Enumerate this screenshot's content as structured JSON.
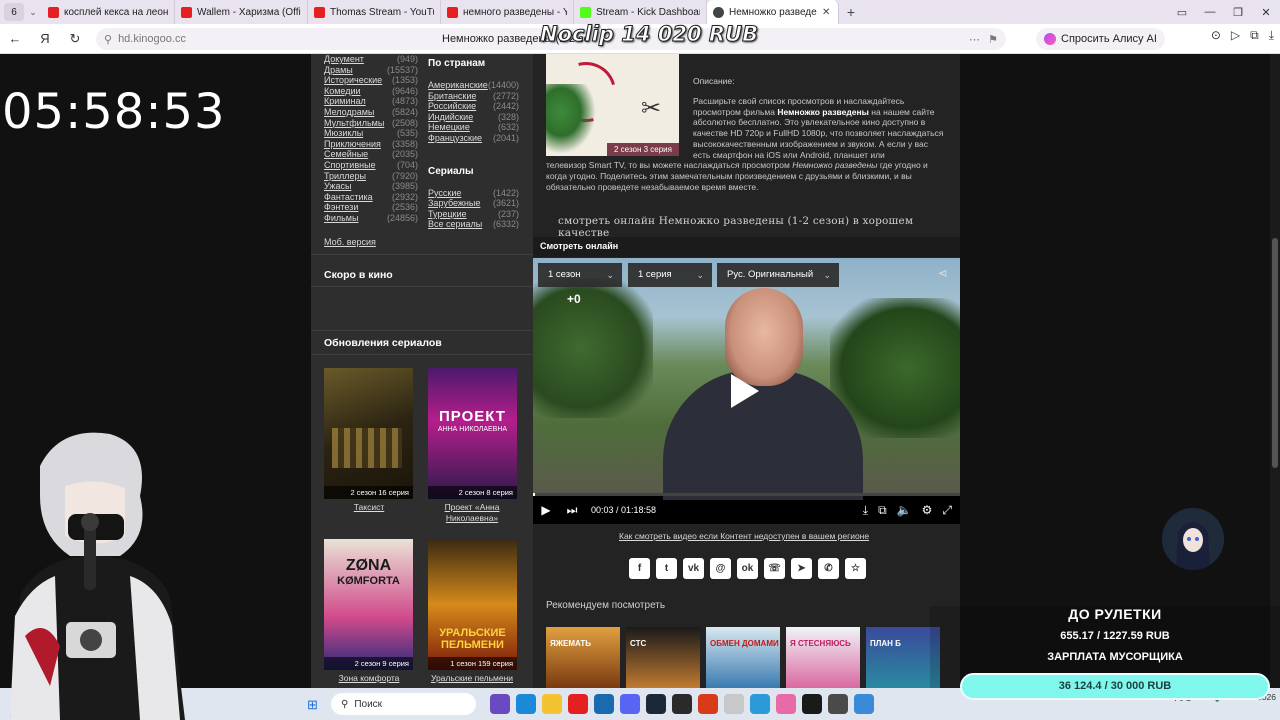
{
  "browser": {
    "tab_count": "6",
    "tabs": [
      {
        "label": "косплей кекса на леона -",
        "color": "#e52020"
      },
      {
        "label": "Wallem - Харизма (Offici",
        "color": "#e52020"
      },
      {
        "label": "Thomas Stream - YouTub",
        "color": "#e52020"
      },
      {
        "label": "немного разведены - You",
        "color": "#e52020"
      },
      {
        "label": "Stream - Kick Dashboard",
        "color": "#53fc18"
      },
      {
        "label": "Немножко разведены",
        "color": "#444444"
      }
    ],
    "url": "hd.kinogoo.cc",
    "page_title": "Немножко разведены (1-2 се",
    "alice_label": "Спросить Алису AI"
  },
  "overlay": {
    "title": "Noclip 14 020 RUB",
    "clock": "05:58:53",
    "roulette_title": "ДО РУЛЕТКИ",
    "roulette_value": "655.17 / 1227.59 RUB",
    "salary_title": "ЗАРПЛАТА МУСОРЩИКА",
    "salary_value": "36 124.4 / 30 000 RUB"
  },
  "sidebar": {
    "genres": [
      {
        "name": "Документ",
        "count": "(949)"
      },
      {
        "name": "Драмы",
        "count": "(15537)"
      },
      {
        "name": "Исторические",
        "count": "(1353)"
      },
      {
        "name": "Комедии",
        "count": "(9646)"
      },
      {
        "name": "Криминал",
        "count": "(4873)"
      },
      {
        "name": "Мелодрамы",
        "count": "(5824)"
      },
      {
        "name": "Мультфильмы",
        "count": "(2508)"
      },
      {
        "name": "Мюзиклы",
        "count": "(535)"
      },
      {
        "name": "Приключения",
        "count": "(3358)"
      },
      {
        "name": "Семейные",
        "count": "(2035)"
      },
      {
        "name": "Спортивные",
        "count": "(704)"
      },
      {
        "name": "Триллеры",
        "count": "(7920)"
      },
      {
        "name": "Ужасы",
        "count": "(3985)"
      },
      {
        "name": "Фантастика",
        "count": "(2932)"
      },
      {
        "name": "Фэнтези",
        "count": "(2536)"
      },
      {
        "name": "Фильмы",
        "count": "(24856)"
      }
    ],
    "countries_title": "По странам",
    "countries": [
      {
        "name": "Американские",
        "count": "(14400)"
      },
      {
        "name": "Британские",
        "count": "(2772)"
      },
      {
        "name": "Российские",
        "count": "(2442)"
      },
      {
        "name": "Индийские",
        "count": "(328)"
      },
      {
        "name": "Немецкие",
        "count": "(632)"
      },
      {
        "name": "Французские",
        "count": "(2041)"
      }
    ],
    "series_title": "Сериалы",
    "series": [
      {
        "name": "Русские",
        "count": "(1422)"
      },
      {
        "name": "Зарубежные",
        "count": "(3621)"
      },
      {
        "name": "Турецкие",
        "count": "(237)"
      },
      {
        "name": "Все сериалы",
        "count": "(6332)"
      }
    ],
    "mobile_link": "Моб. версия",
    "soon_title": "Скоро в кино",
    "updates_title": "Обновления сериалов",
    "posters": [
      {
        "badge": "2 сезон 16 серия",
        "caption": "Таксист"
      },
      {
        "badge": "2 сезон 8 серия",
        "caption": "Проект «Анна Николаевна»"
      },
      {
        "badge": "2 сезон 9 серия",
        "caption": "Зона комфорта"
      },
      {
        "badge": "1 сезон 159 серия",
        "caption": "Уральские пельмени"
      }
    ]
  },
  "main": {
    "poster_badge": "2 сезон 3 серия",
    "desc_label": "Описание:",
    "desc_p1": "Расширьте свой список просмотров и наслаждайтесь просмотром фильма",
    "desc_bold": "Немножко разведены",
    "desc_p2": "на нашем сайте абсолютно бесплатно. Это увлекательное кино доступно в качестве HD 720p и FullHD 1080p, что позволяет наслаждаться высококачественным изображением и звуком. А если у вас есть смартфон на iOS или Android, планшет или",
    "desc_p3": "телевизор Smart TV, то вы можете наслаждаться просмотром",
    "desc_italic": "Немножко разведены",
    "desc_p4": "где угодно и когда угодно. Поделитесь этим замечательным произведением с друзьями и близкими, и вы обязательно проведете незабываемое время вместе.",
    "watch_heading": "смотреть онлайн Немножко разведены (1-2 сезон) в хорошем качестве",
    "watch_tab": "Смотреть онлайн",
    "season": "1 сезон",
    "episode": "1 серия",
    "audio": "Рус. Оригинальный",
    "time": "00:03 / 01:18:58",
    "progress": 0.004,
    "region_link": "Как смотреть видео если Контент недоступен в вашем регионе",
    "recommend_title": "Рекомендуем посмотреть",
    "rec_titles": [
      "ЯЖЕМАТЬ",
      "СТС",
      "ОБМЕН ДОМАМИ",
      "Я СТЕСНЯЮСЬ",
      "ПЛАН Б"
    ]
  },
  "taskbar": {
    "search_label": "Поиск",
    "lang": "РУС",
    "date": "01.03.2026"
  }
}
